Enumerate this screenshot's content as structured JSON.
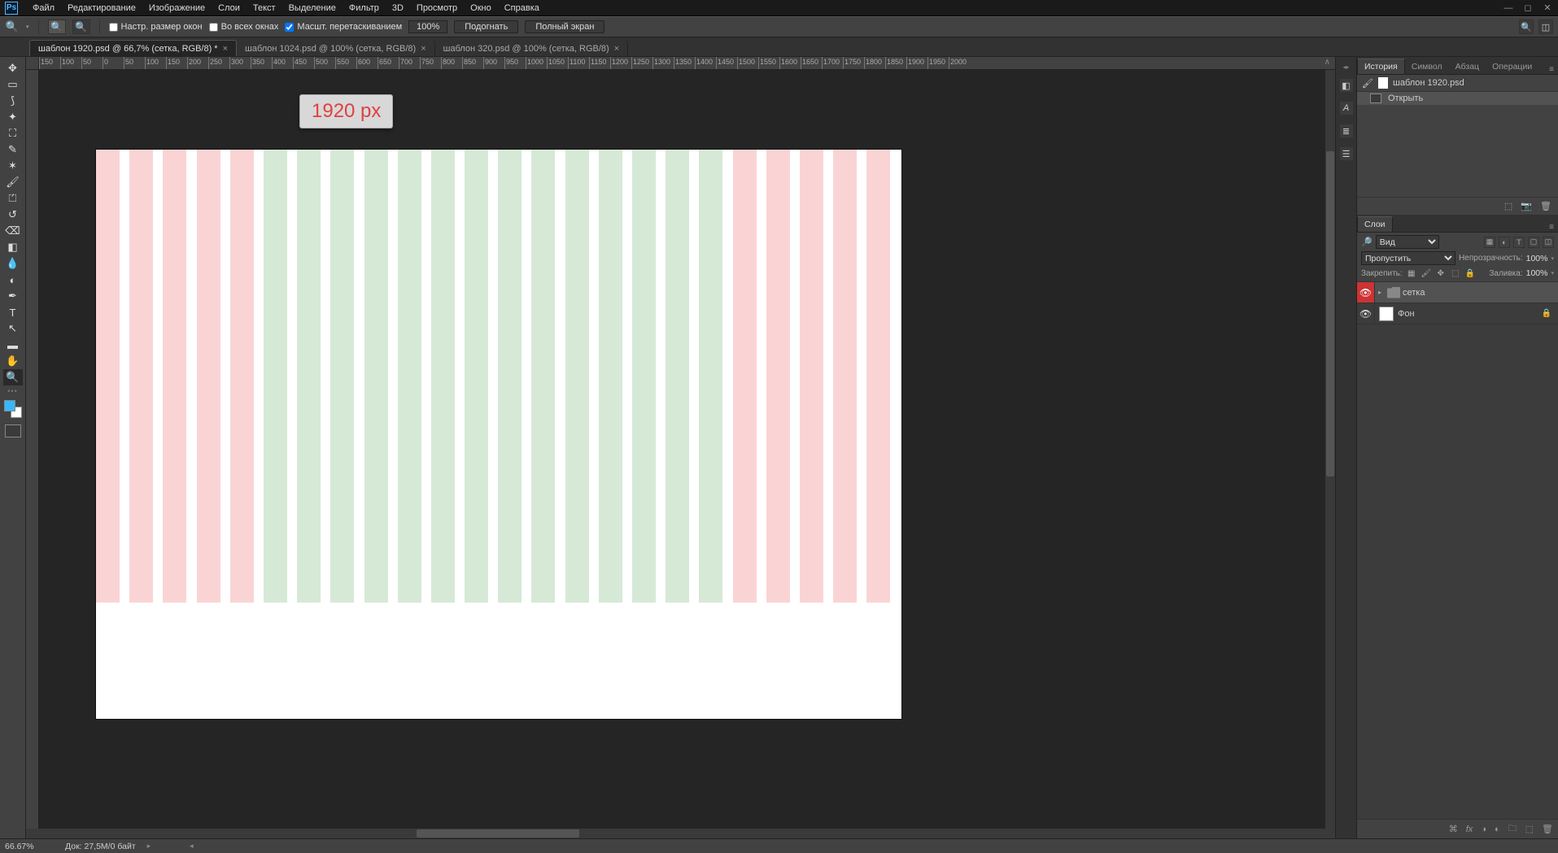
{
  "menu": {
    "items": [
      "Файл",
      "Редактирование",
      "Изображение",
      "Слои",
      "Текст",
      "Выделение",
      "Фильтр",
      "3D",
      "Просмотр",
      "Окно",
      "Справка"
    ]
  },
  "optionsbar": {
    "resize_windows": "Настр. размер окон",
    "all_windows": "Во всех окнах",
    "scrubby": "Масшт. перетаскиванием",
    "zoom_pct": "100%",
    "fit": "Подогнать",
    "fullscreen": "Полный экран"
  },
  "tabs": [
    {
      "label": "шаблон 1920.psd @ 66,7% (сетка, RGB/8) *",
      "active": true
    },
    {
      "label": "шаблон 1024.psd @ 100% (сетка, RGB/8)",
      "active": false
    },
    {
      "label": "шаблон 320.psd @ 100% (сетка, RGB/8)",
      "active": false
    }
  ],
  "ruler_ticks": [
    "150",
    "100",
    "50",
    "0",
    "50",
    "100",
    "150",
    "200",
    "250",
    "300",
    "350",
    "400",
    "450",
    "500",
    "550",
    "600",
    "650",
    "700",
    "750",
    "800",
    "850",
    "900",
    "950",
    "1000",
    "1050",
    "1100",
    "1150",
    "1200",
    "1250",
    "1300",
    "1350",
    "1400",
    "1450",
    "1500",
    "1550",
    "1600",
    "1650",
    "1700",
    "1750",
    "1800",
    "1850",
    "1900",
    "1950",
    "2000"
  ],
  "tooltip": "1920 px",
  "panels": {
    "history": {
      "tabs": [
        "История",
        "Символ",
        "Абзац",
        "Операции"
      ],
      "doc_name": "шаблон 1920.psd",
      "step": "Открыть"
    },
    "layers": {
      "tab": "Слои",
      "kind_label": "Вид",
      "blend": "Пропустить",
      "opacity_label": "Непрозрачность:",
      "opacity_val": "100%",
      "lock_label": "Закрепить:",
      "fill_label": "Заливка:",
      "fill_val": "100%",
      "items": [
        {
          "name": "сетка",
          "type": "group",
          "selected": true,
          "eyeRed": true
        },
        {
          "name": "Фон",
          "type": "layer",
          "locked": true
        }
      ]
    }
  },
  "statusbar": {
    "zoom": "66.67%",
    "docinfo": "Док: 27,5M/0 байт"
  }
}
